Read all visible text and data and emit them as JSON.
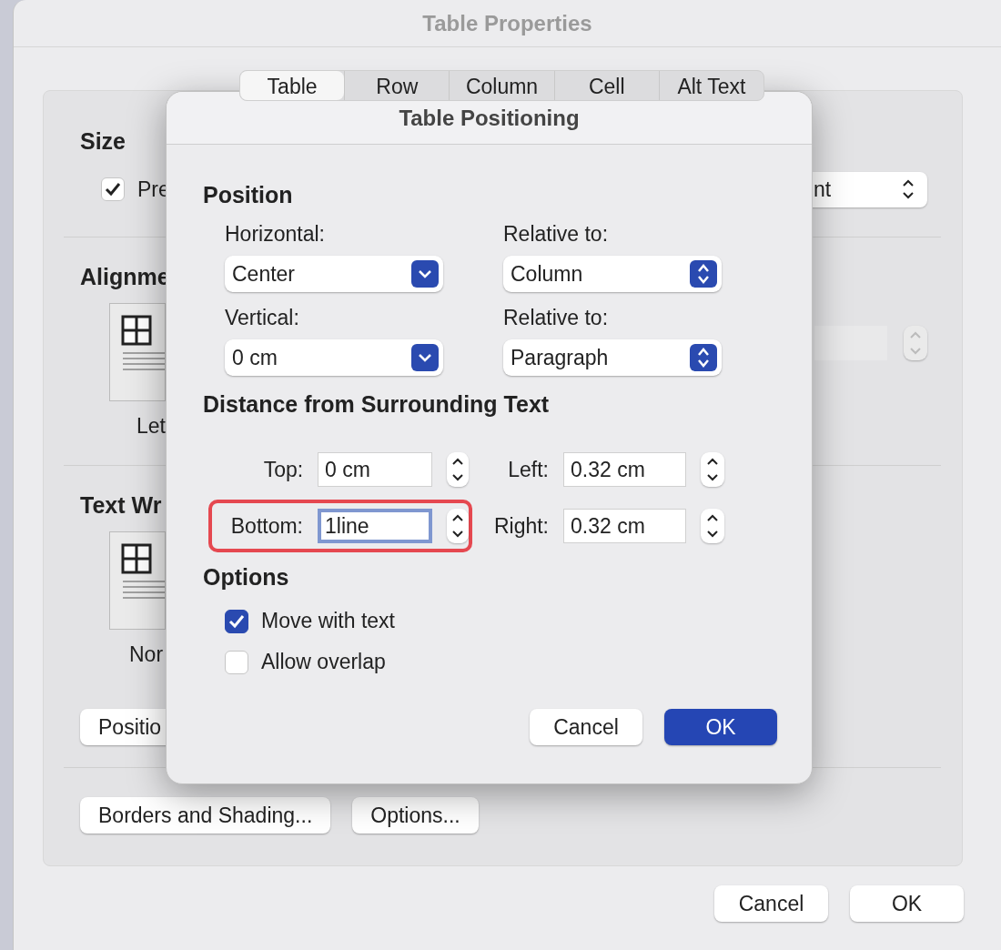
{
  "window": {
    "title": "Table Properties"
  },
  "tabs": [
    {
      "label": "Table",
      "selected": true
    },
    {
      "label": "Row",
      "selected": false
    },
    {
      "label": "Column",
      "selected": false
    },
    {
      "label": "Cell",
      "selected": false
    },
    {
      "label": "Alt Text",
      "selected": false
    }
  ],
  "table_tab": {
    "size": {
      "heading": "Size",
      "preferred_width": {
        "label": "Pre",
        "checked": true
      },
      "measure_in": {
        "value": "nt"
      }
    },
    "alignment": {
      "heading": "Alignme",
      "option_label": "Let",
      "indent_field": {
        "disabled": true
      }
    },
    "text_wrapping": {
      "heading": "Text Wr",
      "option_label": "Nor",
      "positioning_button": "Positio"
    },
    "buttons": [
      "Borders and Shading...",
      "Options..."
    ]
  },
  "footer_buttons": [
    "Cancel",
    "OK"
  ],
  "positioning_dialog": {
    "title": "Table Positioning",
    "position": {
      "heading": "Position",
      "fields": [
        {
          "label": "Horizontal:",
          "value": "Center",
          "kind": "combo"
        },
        {
          "label": "Relative to:",
          "value": "Column",
          "kind": "popup"
        },
        {
          "label": "Vertical:",
          "value": "0 cm",
          "kind": "combo"
        },
        {
          "label": "Relative to:",
          "value": "Paragraph",
          "kind": "popup"
        }
      ]
    },
    "distance": {
      "heading": "Distance from Surrounding Text",
      "fields": [
        {
          "label": "Top:",
          "value": "0 cm",
          "focused": false,
          "highlighted": false
        },
        {
          "label": "Left:",
          "value": "0.32 cm",
          "focused": false,
          "highlighted": false
        },
        {
          "label": "Bottom:",
          "value": "1line",
          "focused": true,
          "highlighted": true
        },
        {
          "label": "Right:",
          "value": "0.32 cm",
          "focused": false,
          "highlighted": false
        }
      ]
    },
    "options": {
      "heading": "Options",
      "checkboxes": [
        {
          "label": "Move with text",
          "checked": true
        },
        {
          "label": "Allow overlap",
          "checked": false
        }
      ]
    },
    "buttons": [
      {
        "label": "Cancel",
        "default": false
      },
      {
        "label": "OK",
        "default": true
      }
    ]
  }
}
